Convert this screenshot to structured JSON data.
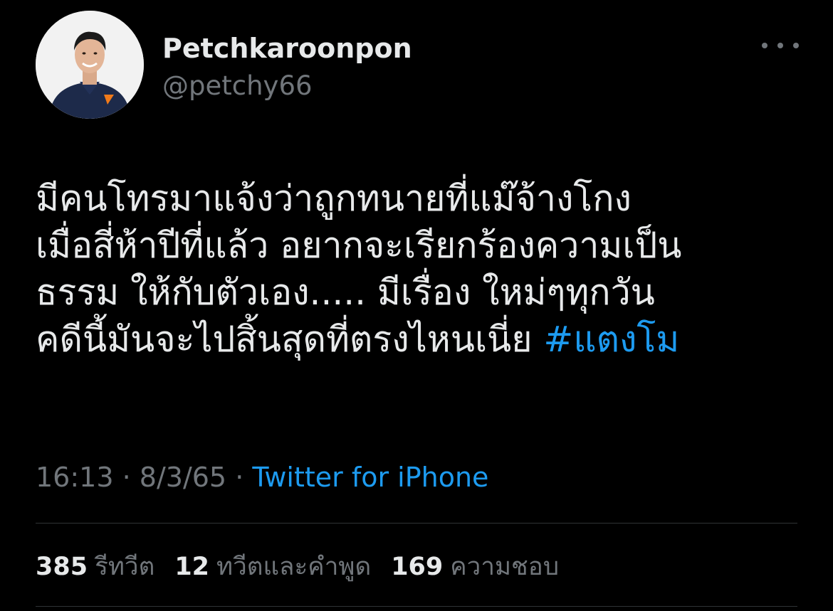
{
  "author": {
    "display_name": "Petchkaroonpon",
    "handle": "@petchy66",
    "avatar_icon": "profile-photo-avatar",
    "more_icon": "more-horizontal-icon"
  },
  "tweet": {
    "text_lines": [
      "มีคนโทรมาแจ้งว่าถูกทนายที่แม๊จ้างโกง",
      "เมื่อสี่ห้าปีที่แล้ว อยากจะเรียกร้องความเป็น",
      "ธรรม ให้กับตัวเอง..... มีเรื่อง ใหม่ๆทุกวัน",
      "คดีนี้มันจะไปสิ้นสุดที่ตรงไหนเนี่ย"
    ],
    "hashtag": "#แตงโม"
  },
  "meta": {
    "time": "16:13",
    "separator": "·",
    "date": "8/3/65",
    "source": "Twitter for iPhone"
  },
  "stats": {
    "retweets": {
      "count": "385",
      "label": "รีทวีต"
    },
    "quotes": {
      "count": "12",
      "label": "ทวีตและคำพูด"
    },
    "likes": {
      "count": "169",
      "label": "ความชอบ"
    }
  },
  "colors": {
    "background": "#000000",
    "text_primary": "#e7e9ea",
    "text_secondary": "#71767b",
    "link": "#1d9bf0",
    "divider": "#2f3336"
  }
}
